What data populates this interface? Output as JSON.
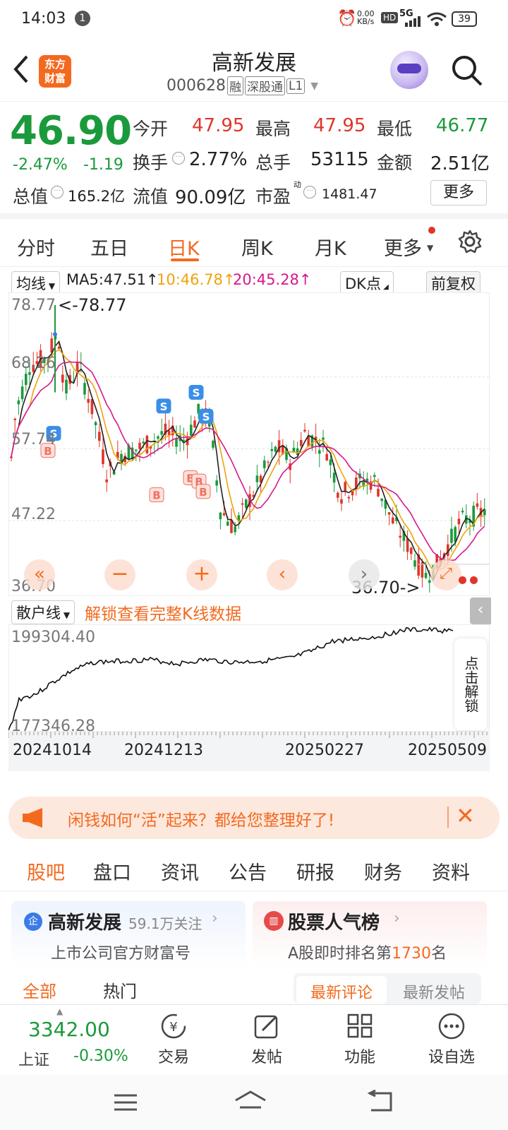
{
  "status": {
    "time": "14:03",
    "notif_badge": "1",
    "net_speed": "0.00",
    "net_unit": "KB/s",
    "hd": "HD",
    "signal": "5G",
    "battery": "39"
  },
  "header": {
    "logo_top": "东方",
    "logo_bottom": "财富",
    "title": "高新发展",
    "code": "000628",
    "tag_rong": "融",
    "tag_shen": "深股通",
    "tag_level": "L1"
  },
  "quote": {
    "price": "46.90",
    "change_pct": "-2.47%",
    "change": "-1.19",
    "open_label": "今开",
    "open": "47.95",
    "high_label": "最高",
    "high": "47.95",
    "low_label": "最低",
    "low": "46.77",
    "turnover_label": "换手",
    "turnover": "2.77%",
    "volume_label": "总手",
    "volume": "53115",
    "amount_label": "金额",
    "amount": "2.51亿",
    "mktcap_label": "总值",
    "mktcap": "165.2亿",
    "float_label": "流值",
    "float": "90.09亿",
    "pe_label": "市盈",
    "pe_sup": "动",
    "pe": "1481.47",
    "more": "更多"
  },
  "period_tabs": [
    "分时",
    "五日",
    "日K",
    "周K",
    "月K",
    "更多"
  ],
  "chart_toolbar": {
    "ma_select": "均线",
    "ma5": "MA5:47.51↑",
    "ma10": "10:46.78↑",
    "ma20": "20:45.28↑",
    "dk": "DK点",
    "fq": "前复权"
  },
  "chart_data": {
    "type": "candlestick",
    "y_ticks": [
      "78.77",
      "68.26",
      "57.74",
      "47.22",
      "36.70"
    ],
    "ylim": [
      36.7,
      78.77
    ],
    "max_label": "<-78.77",
    "min_label": "36.70->",
    "markers": [
      {
        "label": "S"
      },
      {
        "label": "S"
      },
      {
        "label": "S"
      },
      {
        "label": "S"
      },
      {
        "label": "B"
      },
      {
        "label": "B"
      },
      {
        "label": "B"
      },
      {
        "label": "B"
      }
    ],
    "sub_chart": {
      "select": "散户线",
      "unlock_text": "解锁查看完整K线数据",
      "y_ticks": [
        "199304.40",
        "177346.28"
      ],
      "side_unlock": "点击解锁"
    },
    "x_ticks": [
      "20241014",
      "20241213",
      "20250227",
      "20250509"
    ]
  },
  "ad": {
    "text": "闲钱如何“活”起来？都给您整理好了!"
  },
  "section_tabs": [
    "股吧",
    "盘口",
    "资讯",
    "公告",
    "研报",
    "财务",
    "资料"
  ],
  "cards": {
    "company": {
      "name": "高新发展",
      "follow": "59.1万关注",
      "sub": "上市公司官方财富号"
    },
    "rank": {
      "title": "股票人气榜",
      "sub_pre": "A股即时排名第",
      "rank": "1730",
      "sub_post": "名"
    }
  },
  "peek": {
    "left1": "全部",
    "left2": "热门",
    "right1": "最新评论",
    "right2": "最新发帖"
  },
  "bottom": {
    "index_value": "3342.00",
    "index_name": "上证",
    "index_change": "-0.30%",
    "trade": "交易",
    "post": "发帖",
    "func": "功能",
    "watch": "设自选"
  }
}
